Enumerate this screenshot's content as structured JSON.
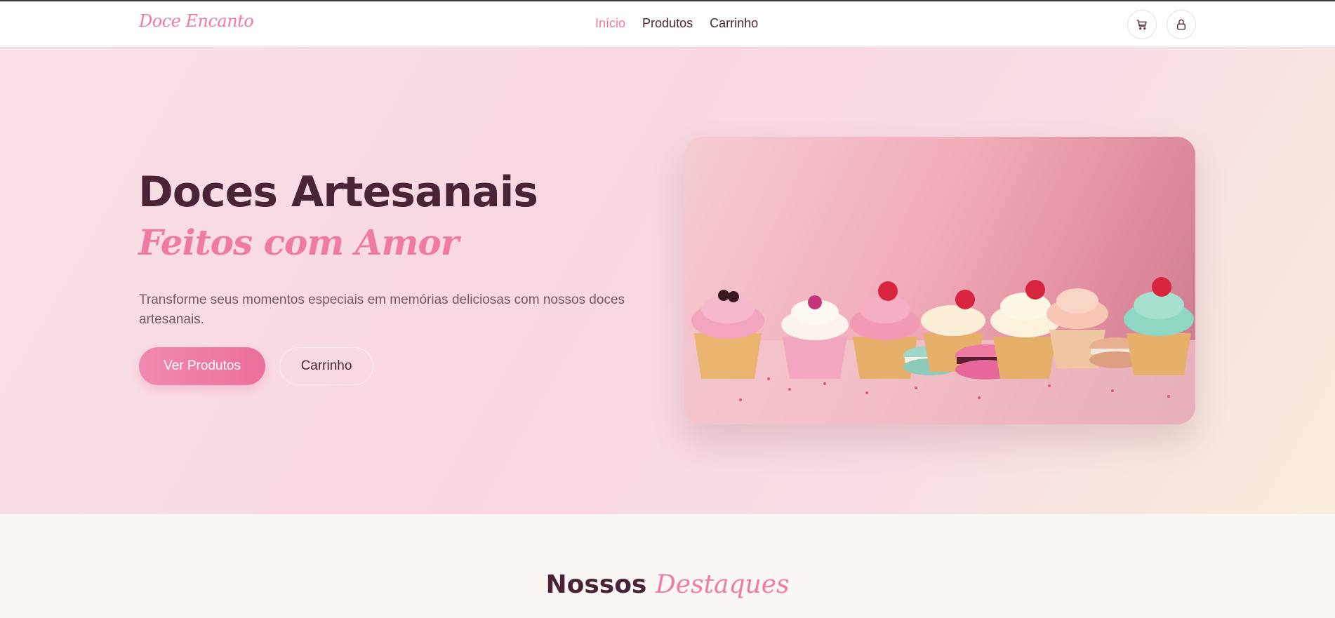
{
  "nav": {
    "brand": "Doce Encanto",
    "links": [
      {
        "label": "Início",
        "active": true
      },
      {
        "label": "Produtos",
        "active": false
      },
      {
        "label": "Carrinho",
        "active": false
      }
    ],
    "icons": [
      "cart-icon",
      "lock-icon"
    ]
  },
  "hero": {
    "title": "Doces Artesanais",
    "subtitle": "Feitos com Amor",
    "description": "Transforme seus momentos especiais em memórias deliciosas com nossos doces artesanais.",
    "primary_button": "Ver Produtos",
    "secondary_button": "Carrinho"
  },
  "section": {
    "title_part1": "Nossos",
    "title_part2": "Destaques"
  },
  "colors": {
    "accent": "#ef7aa4",
    "text": "#4a2336",
    "muted": "#7a5566"
  }
}
